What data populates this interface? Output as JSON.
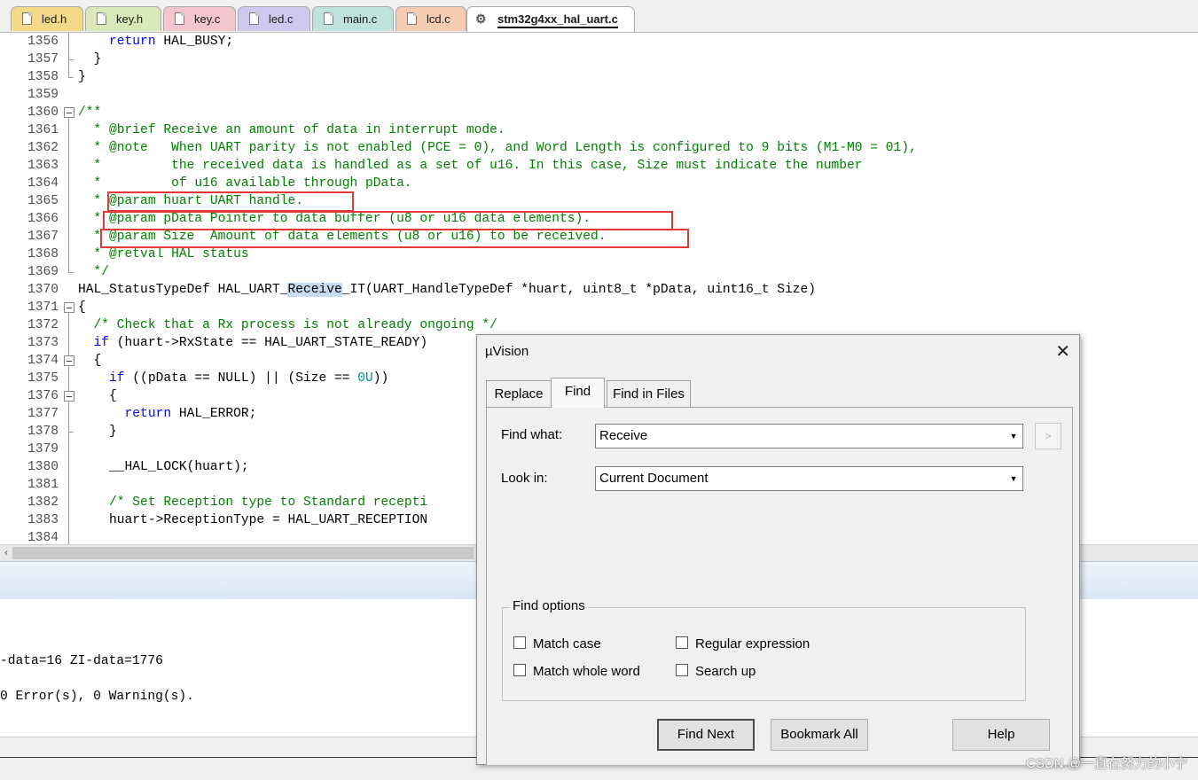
{
  "tabs": [
    {
      "label": "led.h",
      "color": "#f4d988"
    },
    {
      "label": "key.h",
      "color": "#d8e8b8"
    },
    {
      "label": "key.c",
      "color": "#f3c6cf"
    },
    {
      "label": "led.c",
      "color": "#cfc8ee"
    },
    {
      "label": "main.c",
      "color": "#bfe2dd"
    },
    {
      "label": "lcd.c",
      "color": "#f6cdb3"
    },
    {
      "label": "stm32g4xx_hal_uart.c",
      "color": "#ffffff"
    }
  ],
  "editor": {
    "lines": [
      {
        "n": "1356"
      },
      {
        "n": "1357"
      },
      {
        "n": "1358"
      },
      {
        "n": "1359"
      },
      {
        "n": "1360"
      },
      {
        "n": "1361"
      },
      {
        "n": "1362"
      },
      {
        "n": "1363"
      },
      {
        "n": "1364"
      },
      {
        "n": "1365"
      },
      {
        "n": "1366"
      },
      {
        "n": "1367"
      },
      {
        "n": "1368"
      },
      {
        "n": "1369"
      },
      {
        "n": "1370"
      },
      {
        "n": "1371"
      },
      {
        "n": "1372"
      },
      {
        "n": "1373"
      },
      {
        "n": "1374"
      },
      {
        "n": "1375"
      },
      {
        "n": "1376"
      },
      {
        "n": "1377"
      },
      {
        "n": "1378"
      },
      {
        "n": "1379"
      },
      {
        "n": "1380"
      },
      {
        "n": "1381"
      },
      {
        "n": "1382"
      },
      {
        "n": "1383"
      },
      {
        "n": "1384"
      }
    ],
    "t": {
      "l1356_kw": "return",
      "l1356_rest": " HAL_BUSY;",
      "l1357": "}",
      "l1358": "}",
      "l1360": "/**",
      "l1361": "  * @brief Receive an amount of data in interrupt mode.",
      "l1362": "  * @note   When UART parity is not enabled (PCE = 0), and Word Length is configured to 9 bits (M1-M0 = 01),",
      "l1363": "  *         the received data is handled as a set of u16. In this case, Size must indicate the number",
      "l1364": "  *         of u16 available through pData.",
      "l1365": "  * @param huart UART handle.",
      "l1366": "  * @param pData Pointer to data buffer (u8 or u16 data elements).",
      "l1367": "  * @param Size  Amount of data elements (u8 or u16) to be received.",
      "l1368": "  * @retval HAL status",
      "l1369": "  */",
      "l1370_a": "HAL_StatusTypeDef HAL_UART_",
      "l1370_hl": "Receive",
      "l1370_b": "_IT(UART_HandleTypeDef *huart, uint8_t *pData, uint16_t Size)",
      "l1371": "{",
      "l1372": "  /* Check that a Rx process is not already ongoing */",
      "l1373_kw": "if",
      "l1373_rest": " (huart->RxState == HAL_UART_STATE_READY)",
      "l1374": "{",
      "l1375_kw": "if",
      "l1375_a": " ((pData == NULL) || (Size == ",
      "l1375_num": "0U",
      "l1375_b": "))",
      "l1376": "{",
      "l1377_kw": "return",
      "l1377_rest": " HAL_ERROR;",
      "l1378": "}",
      "l1380": "__HAL_LOCK(huart);",
      "l1382": "/* Set Reception type to Standard recepti",
      "l1383": "huart->ReceptionType = HAL_UART_RECEPTION"
    }
  },
  "output": {
    "line1": "-data=16 ZI-data=1776",
    "line2": "0 Error(s), 0 Warning(s)."
  },
  "dialog": {
    "title": "µVision",
    "tabs": {
      "replace": "Replace",
      "find": "Find",
      "find_in_files": "Find in Files"
    },
    "find_what_label": "Find what:",
    "find_what_value": "Receive",
    "look_in_label": "Look in:",
    "look_in_value": "Current Document",
    "more_button": ">",
    "options_title": "Find options",
    "options": {
      "match_case": "Match case",
      "regular_expression": "Regular expression",
      "match_whole_word": "Match whole word",
      "search_up": "Search up"
    },
    "buttons": {
      "find_next": "Find Next",
      "bookmark_all": "Bookmark All",
      "help": "Help"
    }
  },
  "watermark": "CSDN @一直在努力的小宁"
}
